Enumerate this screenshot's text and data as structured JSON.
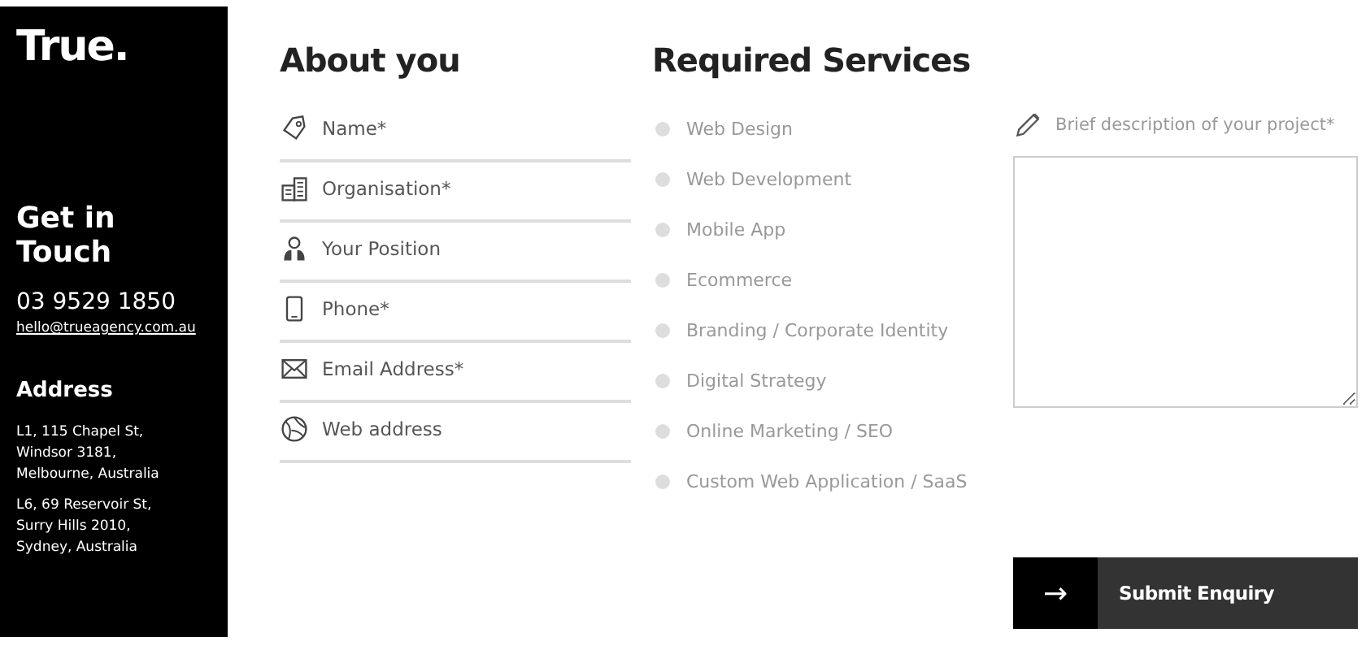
{
  "sidebar": {
    "logo": "True.",
    "heading": "Get in Touch",
    "phone": "03 9529 1850",
    "email": "hello@trueagency.com.au",
    "address_heading": "Address",
    "addresses": [
      [
        "L1, 115 Chapel St,",
        "Windsor 3181,",
        "Melbourne, Australia"
      ],
      [
        "L6, 69 Reservoir St,",
        "Surry Hills 2010,",
        "Sydney, Australia"
      ]
    ]
  },
  "about": {
    "title": "About you",
    "fields": [
      {
        "kind": "tag",
        "placeholder": "Name*"
      },
      {
        "kind": "building",
        "placeholder": "Organisation*"
      },
      {
        "kind": "person",
        "placeholder": "Your Position"
      },
      {
        "kind": "phone",
        "placeholder": "Phone*"
      },
      {
        "kind": "mail",
        "placeholder": "Email Address*"
      },
      {
        "kind": "globe",
        "placeholder": "Web address"
      }
    ]
  },
  "services": {
    "title": "Required Services",
    "items": [
      {
        "label": "Web Design",
        "checked": false
      },
      {
        "label": "Web Development",
        "checked": false
      },
      {
        "label": "Mobile App",
        "checked": false
      },
      {
        "label": "Ecommerce",
        "checked": false
      },
      {
        "label": "Branding / Corporate Identity",
        "checked": false
      },
      {
        "label": "Digital Strategy",
        "checked": false
      },
      {
        "label": "Online Marketing / SEO",
        "checked": false
      },
      {
        "label": "Custom Web Application / SaaS",
        "checked": false
      }
    ]
  },
  "description": {
    "label": "Brief description of your project*"
  },
  "submit": {
    "arrow": "→",
    "label": "Submit Enquiry"
  }
}
